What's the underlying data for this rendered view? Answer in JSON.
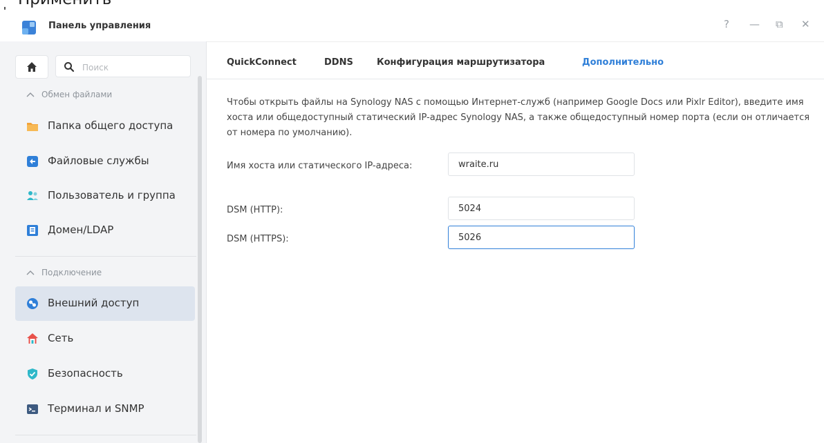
{
  "top_label": "Применить",
  "window": {
    "title": "Панель управления",
    "controls": {
      "help": "?",
      "minimize": "—",
      "restore": "⧉",
      "close": "✕"
    }
  },
  "sidebar": {
    "search_placeholder": "Поиск",
    "sections": [
      {
        "label": "Обмен файлами"
      },
      {
        "label": "Подключение"
      }
    ],
    "items": [
      {
        "label": "Папка общего доступа",
        "icon": "folder-icon"
      },
      {
        "label": "Файловые службы",
        "icon": "file-services-icon"
      },
      {
        "label": "Пользователь и группа",
        "icon": "users-icon"
      },
      {
        "label": "Домен/LDAP",
        "icon": "domain-icon"
      },
      {
        "label": "Внешний доступ",
        "icon": "external-access-icon",
        "selected": true
      },
      {
        "label": "Сеть",
        "icon": "network-house-icon"
      },
      {
        "label": "Безопасность",
        "icon": "shield-icon"
      },
      {
        "label": "Терминал и SNMP",
        "icon": "terminal-icon"
      }
    ]
  },
  "tabs": [
    {
      "label": "QuickConnect"
    },
    {
      "label": "DDNS"
    },
    {
      "label": "Конфигурация маршрутизатора"
    },
    {
      "label": "Дополнительно",
      "active": true
    }
  ],
  "description": "Чтобы открыть файлы на Synology NAS с помощью Интернет-служб (например Google Docs или Pixlr Editor), введите имя хоста или общедоступный статический IP-адрес Synology NAS, а также общедоступный номер порта (если он отличается от номера по умолчанию).",
  "form": {
    "hostname": {
      "label": "Имя хоста или статического IP-адреса:",
      "value": "wraite.ru"
    },
    "http": {
      "label": "DSM (HTTP):",
      "value": "5024"
    },
    "https": {
      "label": "DSM (HTTPS):",
      "value": "5026"
    }
  },
  "colors": {
    "accent": "#2f7fd8",
    "selected_bg": "#dde4ee",
    "sidebar_bg": "#f3f4f6"
  }
}
